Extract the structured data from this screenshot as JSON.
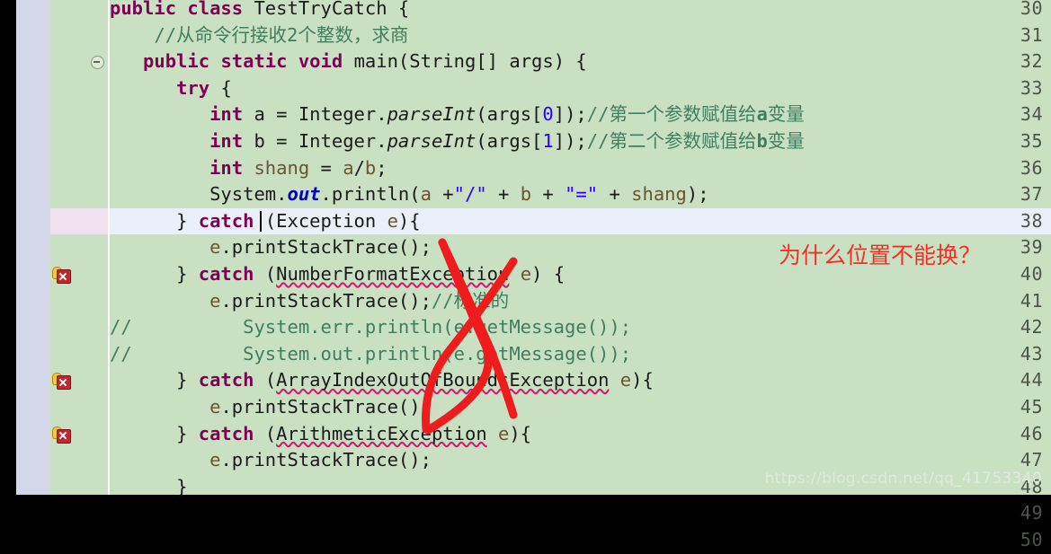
{
  "editor": {
    "language": "java",
    "colors": {
      "background": "#c9e0c3",
      "gutter_rail": "#d3d7e8",
      "change_bar": "#6aa9d8",
      "current_line": "#e9f0f8",
      "keyword": "#7f0055",
      "comment": "#3f7f5f",
      "string": "#2a00ff",
      "field": "#0000c0",
      "parameter": "#6a5531",
      "error_squiggle": "#d41a6e",
      "annotation_red": "#ee3224"
    },
    "first_line": 30,
    "last_line": 50,
    "lines": [
      {
        "n": "30",
        "marker": "none",
        "fold": false,
        "current": false
      },
      {
        "n": "31",
        "marker": "none",
        "fold": false,
        "current": false
      },
      {
        "n": "32",
        "marker": "none",
        "fold": true,
        "current": false
      },
      {
        "n": "33",
        "marker": "none",
        "fold": false,
        "current": false
      },
      {
        "n": "34",
        "marker": "none",
        "fold": false,
        "current": false
      },
      {
        "n": "35",
        "marker": "none",
        "fold": false,
        "current": false
      },
      {
        "n": "36",
        "marker": "none",
        "fold": false,
        "current": false
      },
      {
        "n": "37",
        "marker": "none",
        "fold": false,
        "current": false
      },
      {
        "n": "38",
        "marker": "none",
        "fold": false,
        "current": true
      },
      {
        "n": "39",
        "marker": "none",
        "fold": false,
        "current": false
      },
      {
        "n": "40",
        "marker": "error-quickfix",
        "fold": false,
        "current": false
      },
      {
        "n": "41",
        "marker": "none",
        "fold": false,
        "current": false
      },
      {
        "n": "42",
        "marker": "none",
        "fold": false,
        "current": false
      },
      {
        "n": "43",
        "marker": "none",
        "fold": false,
        "current": false
      },
      {
        "n": "44",
        "marker": "error-quickfix",
        "fold": false,
        "current": false
      },
      {
        "n": "45",
        "marker": "none",
        "fold": false,
        "current": false
      },
      {
        "n": "46",
        "marker": "error-quickfix",
        "fold": false,
        "current": false
      },
      {
        "n": "47",
        "marker": "none",
        "fold": false,
        "current": false
      },
      {
        "n": "48",
        "marker": "none",
        "fold": false,
        "current": false
      },
      {
        "n": "49",
        "marker": "none",
        "fold": false,
        "current": false
      },
      {
        "n": "50",
        "marker": "none",
        "fold": false,
        "current": false
      }
    ],
    "code_plain": [
      "public class TestTryCatch {",
      "    //从命令行接收2个整数，求商",
      "    public static void main(String[] args) {",
      "        try {",
      "            int a = Integer.parseInt(args[0]);//第一个参数赋值给a变量",
      "            int b = Integer.parseInt(args[1]);//第二个参数赋值给b变量",
      "            int shang = a/b;",
      "            System.out.println(a +\"/\" + b + \"=\" + shang);",
      "        } catch (Exception e){",
      "            e.printStackTrace();",
      "        } catch (NumberFormatException e) {",
      "            e.printStackTrace();//标准的",
      "//          System.err.println(e.getMessage());",
      "//          System.out.println(e.getMessage());",
      "        } catch (ArrayIndexOutOfBoundsException e){",
      "            e.printStackTrace();",
      "        } catch (ArithmeticException e){",
      "            e.printStackTrace();",
      "        }",
      "",
      ""
    ],
    "errors": [
      {
        "line": "40",
        "token": "NumberFormatException"
      },
      {
        "line": "44",
        "token": "ArrayIndexOutOfBoundsException"
      },
      {
        "line": "46",
        "token": "ArithmeticException"
      }
    ]
  },
  "annotation": {
    "text": "为什么位置不能换？",
    "mark": "red-cross-out"
  },
  "watermark": {
    "text": "https://blog.csdn.net/qq_41753340"
  }
}
